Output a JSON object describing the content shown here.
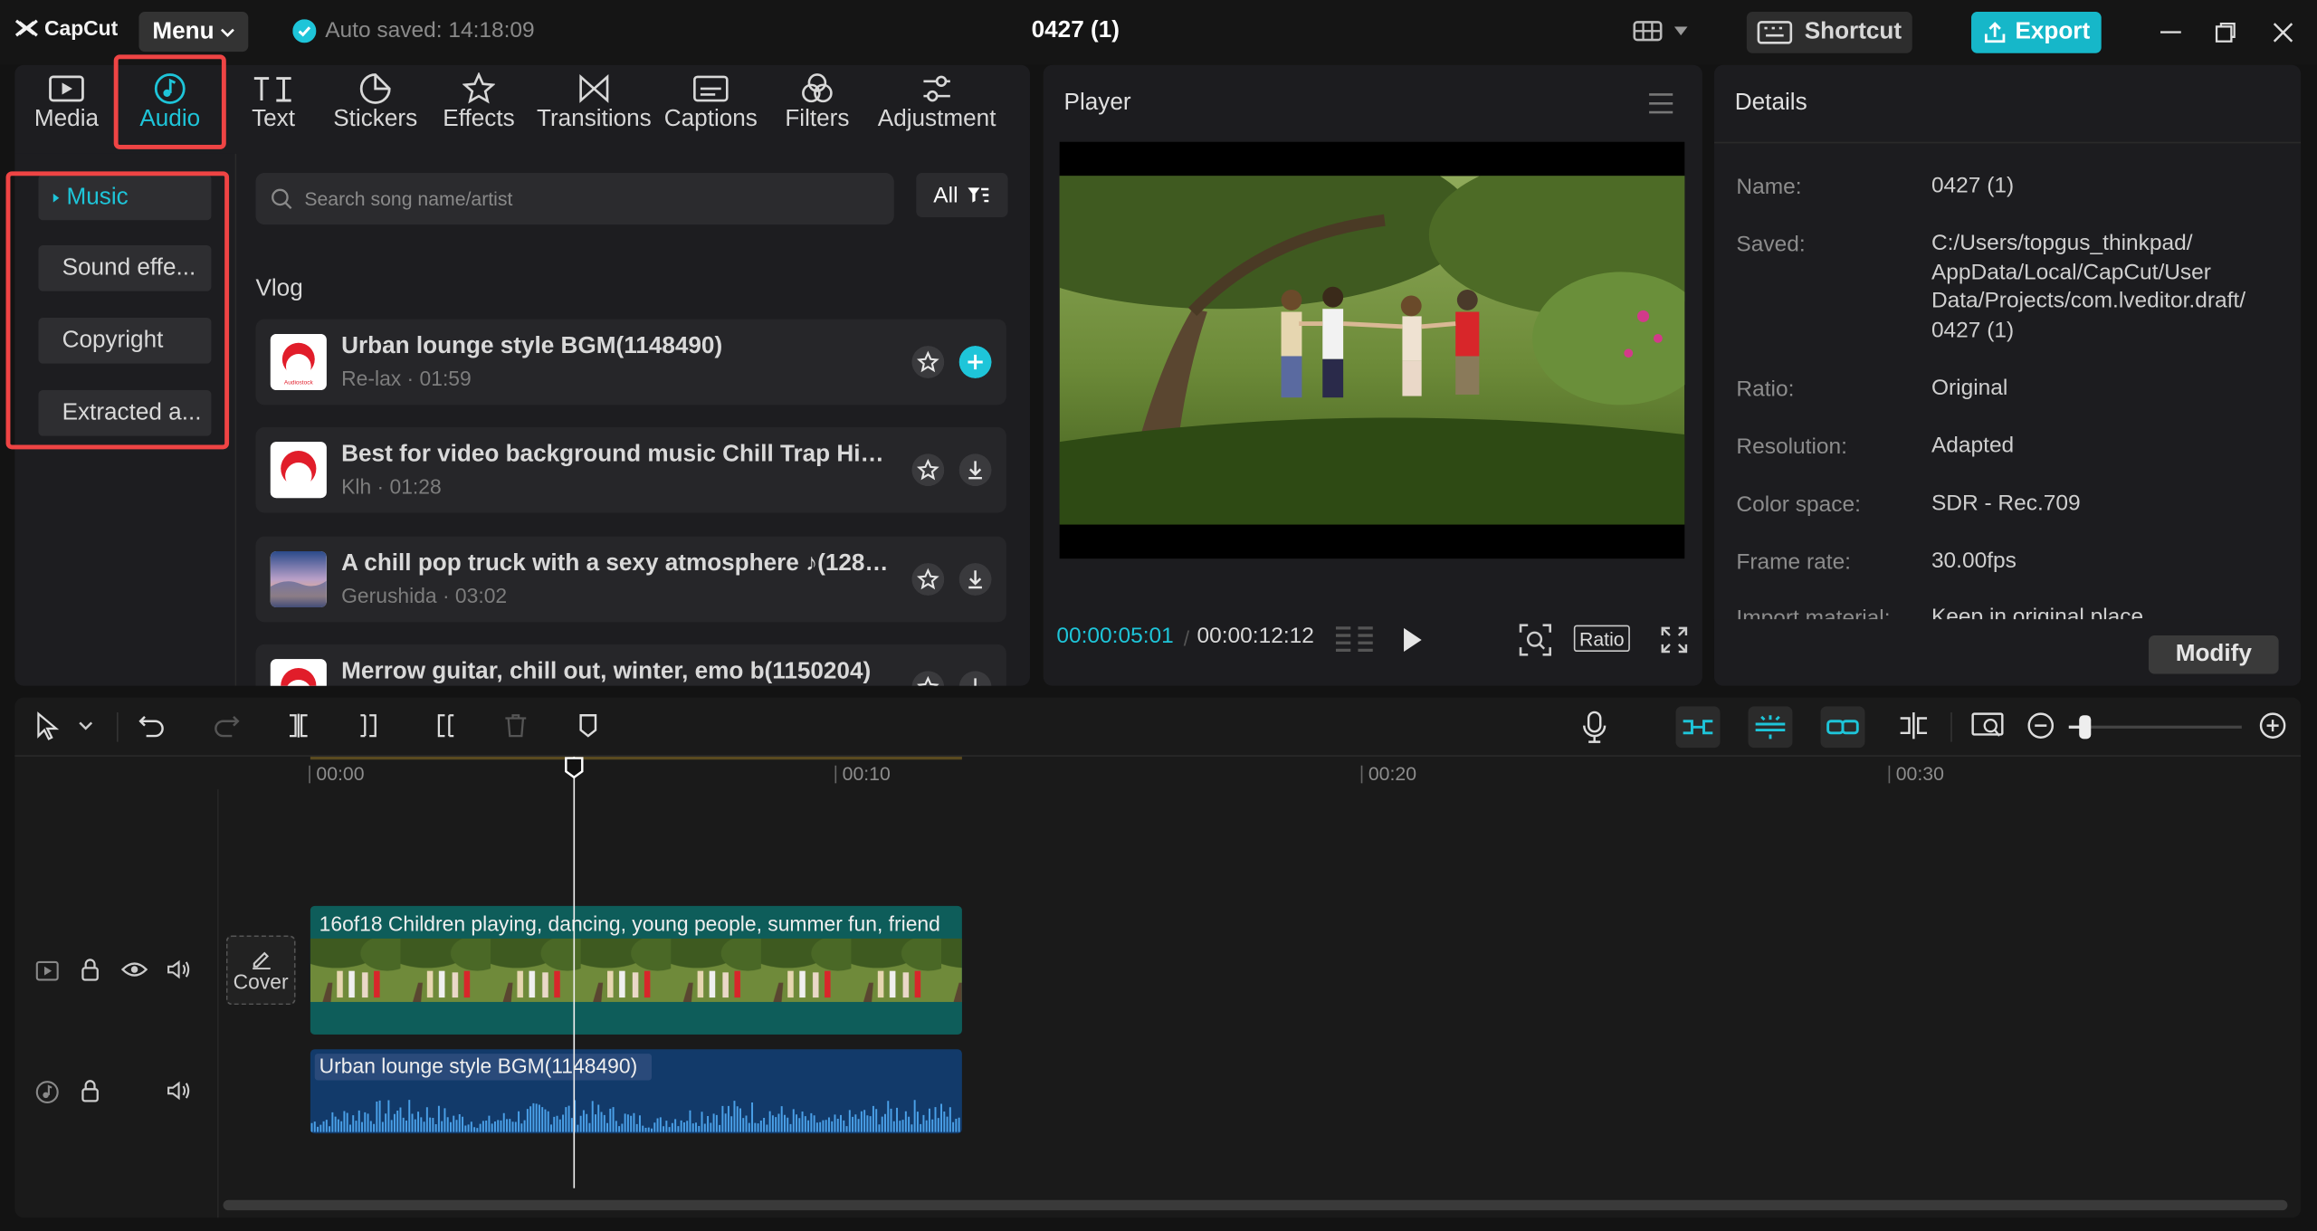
{
  "app": {
    "logo_text": "CapCut",
    "menu_label": "Menu",
    "autosave": "Auto saved: 14:18:09",
    "project_title": "0427 (1)",
    "shortcut_label": "Shortcut",
    "export_label": "Export"
  },
  "colors": {
    "accent": "#1ec5d9",
    "highlight_box": "#ef4444",
    "video_clip": "#0e5d5a",
    "audio_clip": "#123a6a"
  },
  "tabs": [
    {
      "label": "Media",
      "icon": "media-icon"
    },
    {
      "label": "Audio",
      "icon": "audio-icon",
      "active": true
    },
    {
      "label": "Text",
      "icon": "text-icon"
    },
    {
      "label": "Stickers",
      "icon": "sticker-icon"
    },
    {
      "label": "Effects",
      "icon": "effects-icon"
    },
    {
      "label": "Transitions",
      "icon": "transitions-icon"
    },
    {
      "label": "Captions",
      "icon": "captions-icon"
    },
    {
      "label": "Filters",
      "icon": "filters-icon"
    },
    {
      "label": "Adjustment",
      "icon": "adjustment-icon"
    }
  ],
  "sidenav": [
    {
      "label": "Music",
      "active": true
    },
    {
      "label": "Sound effe..."
    },
    {
      "label": "Copyright"
    },
    {
      "label": "Extracted a..."
    }
  ],
  "search": {
    "placeholder": "Search song name/artist",
    "filter_label": "All"
  },
  "section_title": "Vlog",
  "tracks": [
    {
      "title": "Urban lounge style BGM(1148490)",
      "artist": "Re-lax · 01:59",
      "action": "add"
    },
    {
      "title": "Best for video background music Chill Trap Hip ...",
      "artist": "Klh · 01:28",
      "action": "download"
    },
    {
      "title": "A chill pop truck with a sexy atmosphere ♪(1285...",
      "artist": "Gerushida · 03:02",
      "action": "download"
    },
    {
      "title": "Merrow guitar, chill out, winter, emo b(1150204)",
      "artist": "",
      "action": "download"
    }
  ],
  "player": {
    "title": "Player",
    "current_time": "00:00:05:01",
    "total_time": "00:00:12:12",
    "ratio_label": "Ratio"
  },
  "details": {
    "title": "Details",
    "fields": [
      {
        "label": "Name:",
        "value": "0427 (1)"
      },
      {
        "label": "Saved:",
        "value": "C:/Users/topgus_thinkpad/ AppData/Local/CapCut/User Data/Projects/com.lveditor.draft/ 0427 (1)"
      },
      {
        "label": "Ratio:",
        "value": "Original"
      },
      {
        "label": "Resolution:",
        "value": "Adapted"
      },
      {
        "label": "Color space:",
        "value": "SDR - Rec.709"
      },
      {
        "label": "Frame rate:",
        "value": "30.00fps"
      },
      {
        "label": "Import material:",
        "value": "Keep in original place"
      }
    ],
    "modify_label": "Modify"
  },
  "timeline": {
    "ruler": [
      "00:00",
      "00:10",
      "00:20",
      "00:30"
    ],
    "video_clip": "16of18 Children playing, dancing, young people, summer fun, friend",
    "audio_clip": "Urban lounge style BGM(1148490)",
    "cover_label": "Cover"
  }
}
